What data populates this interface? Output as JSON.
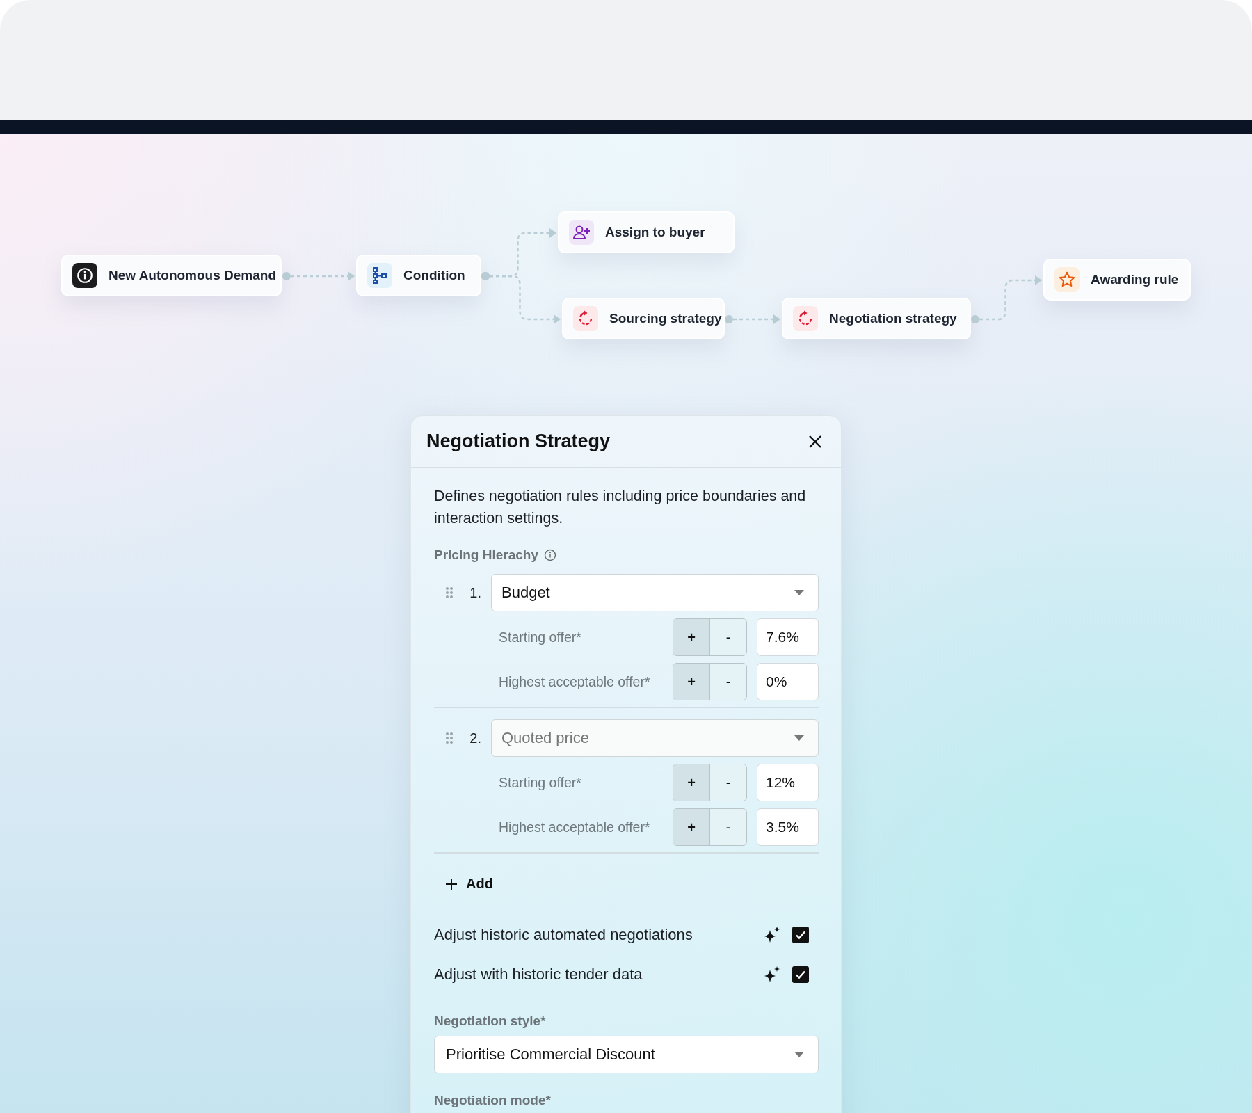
{
  "flow": {
    "nodes": [
      {
        "label": "New Autonomous Demand",
        "kind": "info"
      },
      {
        "label": "Condition",
        "kind": "condition"
      },
      {
        "label": "Assign to buyer",
        "kind": "buyer"
      },
      {
        "label": "Sourcing strategy",
        "kind": "strategy"
      },
      {
        "label": "Negotiation strategy",
        "kind": "strategy"
      },
      {
        "label": "Awarding rule",
        "kind": "award"
      }
    ]
  },
  "panel": {
    "title": "Negotiation Strategy",
    "description": "Defines negotiation rules including price boundaries and interaction settings.",
    "pricing_label": "Pricing Hierachy",
    "tiers": [
      {
        "number": "1.",
        "value": "Budget",
        "disabled": false,
        "offers": [
          {
            "label": "Starting offer*",
            "plus": "+",
            "minus": "-",
            "value": "7.6%"
          },
          {
            "label": "Highest acceptable offer*",
            "plus": "+",
            "minus": "-",
            "value": "0%"
          }
        ]
      },
      {
        "number": "2.",
        "value": "Quoted price",
        "disabled": true,
        "offers": [
          {
            "label": "Starting offer*",
            "plus": "+",
            "minus": "-",
            "value": "12%"
          },
          {
            "label": "Highest acceptable offer*",
            "plus": "+",
            "minus": "-",
            "value": "3.5%"
          }
        ]
      }
    ],
    "add_label": "Add",
    "options": [
      {
        "label": "Adjust historic automated negotiations",
        "checked": true
      },
      {
        "label": "Adjust with historic tender data",
        "checked": true
      }
    ],
    "style_label": "Negotiation style*",
    "style_value": "Prioritise Commercial Discount",
    "mode_label": "Negotiation mode*"
  }
}
